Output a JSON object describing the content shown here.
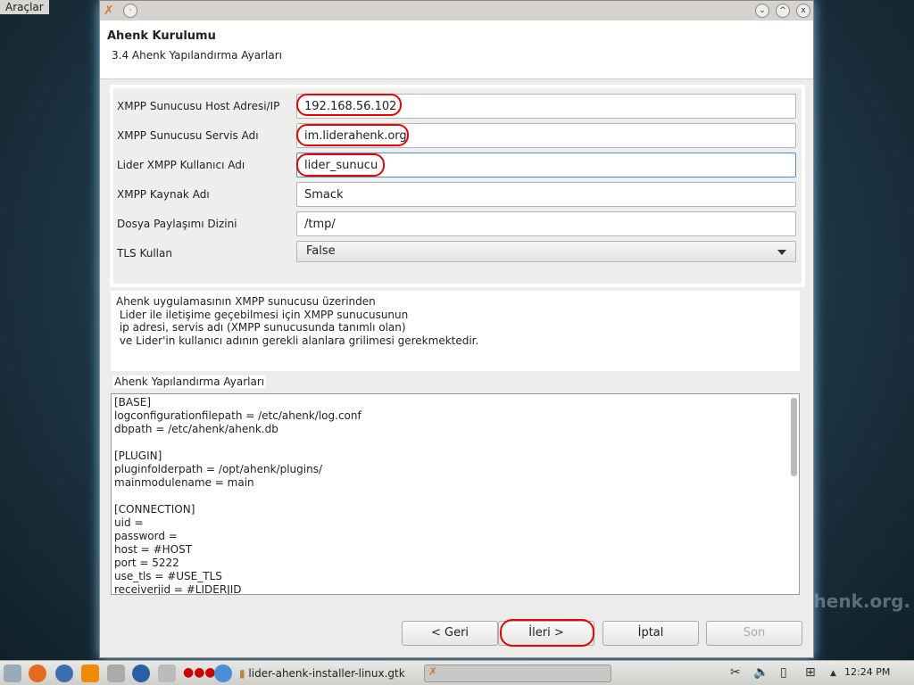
{
  "desktop": {
    "menu": "Araçlar",
    "watermark": "rahenk.org."
  },
  "window": {
    "title_icon": "app-icon",
    "header_title": "Ahenk Kurulumu",
    "header_subtitle": "3.4 Ahenk Yapılandırma Ayarları"
  },
  "form": {
    "fields": [
      {
        "label": "XMPP Sunucusu Host Adresi/IP",
        "value": "192.168.56.102"
      },
      {
        "label": "XMPP Sunucusu Servis Adı",
        "value": "im.liderahenk.org"
      },
      {
        "label": "Lider XMPP Kullanıcı Adı",
        "value": "lider_sunucu"
      },
      {
        "label": "XMPP Kaynak Adı",
        "value": "Smack"
      },
      {
        "label": "Dosya Paylaşımı Dizini",
        "value": "/tmp/"
      },
      {
        "label": "TLS Kullan",
        "value": "False"
      }
    ]
  },
  "description": "Ahenk uygulamasının XMPP sunucusu üzerinden\n Lider ile iletişime geçebilmesi için XMPP sunucusunun\n ip adresi, servis adı (XMPP sunucusunda tanımlı olan)\n ve Lider'in kullanıcı adının gerekli alanlara grilimesi gerekmektedir.",
  "config": {
    "label": "Ahenk Yapılandırma Ayarları",
    "text": "[BASE]\nlogconfigurationfilepath = /etc/ahenk/log.conf\ndbpath = /etc/ahenk/ahenk.db\n\n[PLUGIN]\npluginfolderpath = /opt/ahenk/plugins/\nmainmodulename = main\n\n[CONNECTION]\nuid =\npassword =\nhost = #HOST\nport = 5222\nuse_tls = #USE_TLS\nreceiverjid = #LIDERJID"
  },
  "buttons": {
    "back": "< Geri",
    "next": "İleri >",
    "cancel": "İptal",
    "finish": "Son"
  },
  "taskbar": {
    "task": "lider-ahenk-installer-linux.gtk",
    "clock": "12:24 PM"
  },
  "colors": {
    "highlight": "#e00000",
    "focus": "#4a90d9"
  }
}
